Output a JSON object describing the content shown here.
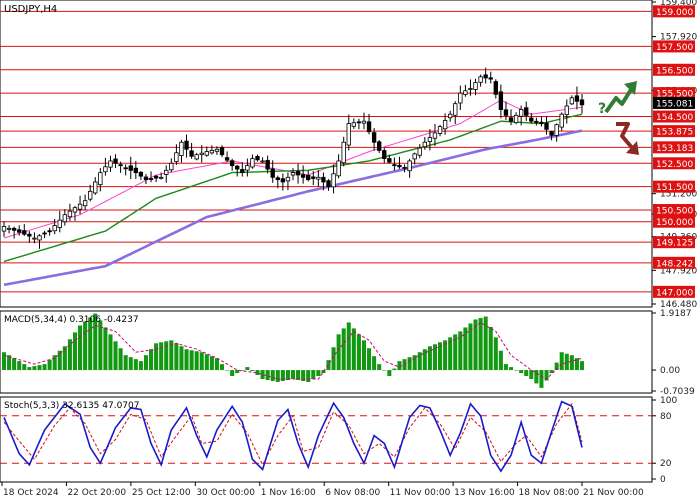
{
  "chart_data": {
    "type": "candlestick",
    "symbol_label": "USDJPY,H4",
    "price_axis": {
      "ylim": [
        146.48,
        159.4
      ],
      "ticks": [
        "159.400",
        "157.920",
        "155.620",
        "151.200",
        "150.320",
        "149.360",
        "147.920",
        "146.480"
      ]
    },
    "x_ticks": [
      "18 Oct 2024",
      "22 Oct 20:00",
      "25 Oct 12:00",
      "30 Oct 00:00",
      "1 Nov 16:00",
      "6 Nov 08:00",
      "11 Nov 00:00",
      "13 Nov 16:00",
      "18 Nov 08:00",
      "21 Nov 00:00"
    ],
    "levels": [
      {
        "label": "159.000",
        "value": 159.0
      },
      {
        "label": "157.500",
        "value": 157.5
      },
      {
        "label": "156.500",
        "value": 156.5
      },
      {
        "label": "155.500",
        "value": 155.5
      },
      {
        "label": "154.500",
        "value": 154.5
      },
      {
        "label": "153.875",
        "value": 153.875
      },
      {
        "label": "153.183",
        "value": 153.183
      },
      {
        "label": "152.500",
        "value": 152.5
      },
      {
        "label": "151.500",
        "value": 151.5
      },
      {
        "label": "150.500",
        "value": 150.5
      },
      {
        "label": "150.000",
        "value": 150.0
      },
      {
        "label": "149.125",
        "value": 149.125
      },
      {
        "label": "148.242",
        "value": 148.242
      },
      {
        "label": "147.000",
        "value": 147.0
      }
    ],
    "current_price": {
      "label": "155.081",
      "value": 155.081
    },
    "close_path": [
      [
        0,
        149.8
      ],
      [
        6,
        149.3
      ],
      [
        9,
        149.6
      ],
      [
        12,
        150.3
      ],
      [
        16,
        150.9
      ],
      [
        19,
        152.1
      ],
      [
        21,
        152.6
      ],
      [
        24,
        152.3
      ],
      [
        26,
        152.1
      ],
      [
        28,
        151.8
      ],
      [
        31,
        151.9
      ],
      [
        33,
        152.5
      ],
      [
        35,
        153.4
      ],
      [
        37,
        152.8
      ],
      [
        40,
        153.0
      ],
      [
        42,
        153.1
      ],
      [
        45,
        152.4
      ],
      [
        47,
        152.1
      ],
      [
        49,
        152.7
      ],
      [
        51,
        152.6
      ],
      [
        53,
        151.9
      ],
      [
        55,
        151.7
      ],
      [
        57,
        152.1
      ],
      [
        60,
        151.8
      ],
      [
        62,
        151.9
      ],
      [
        64,
        151.5
      ],
      [
        66,
        152.6
      ],
      [
        68,
        154.2
      ],
      [
        71,
        154.3
      ],
      [
        73,
        153.4
      ],
      [
        75,
        152.7
      ],
      [
        77,
        152.4
      ],
      [
        79,
        152.3
      ],
      [
        81,
        152.9
      ],
      [
        83,
        153.4
      ],
      [
        85,
        153.8
      ],
      [
        88,
        154.6
      ],
      [
        90,
        155.5
      ],
      [
        92,
        155.7
      ],
      [
        94,
        156.2
      ],
      [
        96,
        156.1
      ],
      [
        98,
        154.8
      ],
      [
        100,
        154.3
      ],
      [
        102,
        154.8
      ],
      [
        104,
        154.3
      ],
      [
        106,
        154.2
      ],
      [
        108,
        153.7
      ],
      [
        110,
        154.6
      ],
      [
        112,
        155.3
      ],
      [
        114,
        155.0
      ]
    ],
    "moving_averages": [
      {
        "color": "#ff44cc",
        "points": [
          [
            0,
            149.3
          ],
          [
            15,
            150.3
          ],
          [
            30,
            152.0
          ],
          [
            45,
            152.6
          ],
          [
            60,
            152.0
          ],
          [
            72,
            153.0
          ],
          [
            90,
            154.2
          ],
          [
            98,
            155.2
          ],
          [
            104,
            154.6
          ],
          [
            114,
            154.9
          ]
        ]
      },
      {
        "color": "#1c8a1c",
        "points": [
          [
            0,
            148.3
          ],
          [
            20,
            149.6
          ],
          [
            30,
            151.0
          ],
          [
            45,
            152.1
          ],
          [
            60,
            152.2
          ],
          [
            72,
            152.6
          ],
          [
            88,
            153.5
          ],
          [
            98,
            154.3
          ],
          [
            106,
            154.2
          ],
          [
            114,
            154.6
          ]
        ]
      },
      {
        "color": "#8a6de0",
        "points": [
          [
            0,
            147.3
          ],
          [
            20,
            148.1
          ],
          [
            40,
            150.2
          ],
          [
            60,
            151.3
          ],
          [
            80,
            152.3
          ],
          [
            95,
            153.1
          ],
          [
            105,
            153.5
          ],
          [
            114,
            153.9
          ]
        ]
      }
    ],
    "macd": {
      "title": "MACD(5,34,4) 0.3106 -0.4237",
      "ticks": [
        "1.9187",
        "0.00",
        "-0.7039"
      ],
      "ylim": [
        -0.7039,
        1.9187
      ],
      "color_hist": "#119911",
      "color_signal": "#cc0077",
      "hist_path": [
        [
          0,
          0.6
        ],
        [
          5,
          0.1
        ],
        [
          8,
          0.2
        ],
        [
          12,
          0.8
        ],
        [
          15,
          1.5
        ],
        [
          18,
          1.9
        ],
        [
          21,
          1.2
        ],
        [
          24,
          0.5
        ],
        [
          27,
          0.3
        ],
        [
          30,
          0.9
        ],
        [
          33,
          1.0
        ],
        [
          36,
          0.7
        ],
        [
          39,
          0.6
        ],
        [
          42,
          0.4
        ],
        [
          45,
          -0.2
        ],
        [
          48,
          0.1
        ],
        [
          51,
          -0.3
        ],
        [
          54,
          -0.4
        ],
        [
          57,
          -0.3
        ],
        [
          60,
          -0.4
        ],
        [
          63,
          -0.1
        ],
        [
          66,
          1.2
        ],
        [
          68,
          1.6
        ],
        [
          71,
          1.0
        ],
        [
          74,
          0.2
        ],
        [
          76,
          -0.2
        ],
        [
          78,
          0.3
        ],
        [
          81,
          0.5
        ],
        [
          84,
          0.8
        ],
        [
          87,
          1.0
        ],
        [
          90,
          1.3
        ],
        [
          93,
          1.7
        ],
        [
          95,
          1.8
        ],
        [
          97,
          1.1
        ],
        [
          99,
          0.2
        ],
        [
          102,
          -0.1
        ],
        [
          104,
          -0.3
        ],
        [
          106,
          -0.6
        ],
        [
          108,
          -0.1
        ],
        [
          110,
          0.6
        ],
        [
          112,
          0.5
        ],
        [
          114,
          0.3
        ]
      ],
      "signal_path": [
        [
          0,
          0.5
        ],
        [
          6,
          0.2
        ],
        [
          10,
          0.4
        ],
        [
          14,
          1.0
        ],
        [
          18,
          1.5
        ],
        [
          22,
          1.3
        ],
        [
          26,
          0.6
        ],
        [
          30,
          0.7
        ],
        [
          34,
          0.9
        ],
        [
          38,
          0.7
        ],
        [
          42,
          0.4
        ],
        [
          46,
          0.0
        ],
        [
          50,
          -0.1
        ],
        [
          54,
          -0.3
        ],
        [
          58,
          -0.3
        ],
        [
          62,
          -0.3
        ],
        [
          66,
          0.7
        ],
        [
          69,
          1.3
        ],
        [
          72,
          1.0
        ],
        [
          75,
          0.3
        ],
        [
          78,
          0.1
        ],
        [
          82,
          0.5
        ],
        [
          86,
          0.8
        ],
        [
          90,
          1.1
        ],
        [
          94,
          1.6
        ],
        [
          97,
          1.3
        ],
        [
          100,
          0.5
        ],
        [
          104,
          0.0
        ],
        [
          107,
          -0.3
        ],
        [
          110,
          0.2
        ],
        [
          114,
          0.4
        ]
      ]
    },
    "stochastic": {
      "title": "Stoch(5,3,3) 32.6135 47.0707",
      "ticks": [
        "100",
        "80",
        "20",
        "0"
      ],
      "ylim": [
        0,
        100
      ],
      "levels": [
        80,
        20
      ],
      "color_main": "#1a1acc",
      "color_signal": "#cc1111",
      "main_path": [
        [
          0,
          78
        ],
        [
          3,
          32
        ],
        [
          5,
          18
        ],
        [
          8,
          62
        ],
        [
          12,
          95
        ],
        [
          15,
          82
        ],
        [
          17,
          40
        ],
        [
          19,
          20
        ],
        [
          22,
          65
        ],
        [
          25,
          90
        ],
        [
          27,
          88
        ],
        [
          29,
          45
        ],
        [
          31,
          18
        ],
        [
          33,
          62
        ],
        [
          36,
          90
        ],
        [
          38,
          55
        ],
        [
          40,
          28
        ],
        [
          42,
          62
        ],
        [
          45,
          92
        ],
        [
          47,
          72
        ],
        [
          49,
          25
        ],
        [
          51,
          12
        ],
        [
          54,
          74
        ],
        [
          56,
          88
        ],
        [
          58,
          45
        ],
        [
          60,
          15
        ],
        [
          62,
          55
        ],
        [
          65,
          96
        ],
        [
          67,
          78
        ],
        [
          69,
          45
        ],
        [
          71,
          20
        ],
        [
          73,
          55
        ],
        [
          75,
          45
        ],
        [
          77,
          15
        ],
        [
          80,
          78
        ],
        [
          82,
          93
        ],
        [
          84,
          90
        ],
        [
          86,
          62
        ],
        [
          88,
          30
        ],
        [
          90,
          58
        ],
        [
          92,
          95
        ],
        [
          94,
          80
        ],
        [
          96,
          30
        ],
        [
          98,
          10
        ],
        [
          100,
          30
        ],
        [
          102,
          72
        ],
        [
          104,
          30
        ],
        [
          106,
          20
        ],
        [
          108,
          60
        ],
        [
          110,
          98
        ],
        [
          112,
          92
        ],
        [
          114,
          40
        ]
      ],
      "signal_path": [
        [
          0,
          72
        ],
        [
          3,
          48
        ],
        [
          6,
          25
        ],
        [
          10,
          68
        ],
        [
          13,
          90
        ],
        [
          16,
          70
        ],
        [
          19,
          32
        ],
        [
          22,
          50
        ],
        [
          25,
          82
        ],
        [
          28,
          75
        ],
        [
          31,
          28
        ],
        [
          34,
          55
        ],
        [
          37,
          80
        ],
        [
          39,
          45
        ],
        [
          42,
          48
        ],
        [
          45,
          82
        ],
        [
          48,
          58
        ],
        [
          51,
          18
        ],
        [
          54,
          55
        ],
        [
          57,
          80
        ],
        [
          59,
          35
        ],
        [
          62,
          40
        ],
        [
          65,
          85
        ],
        [
          68,
          68
        ],
        [
          71,
          32
        ],
        [
          74,
          45
        ],
        [
          77,
          28
        ],
        [
          80,
          65
        ],
        [
          83,
          90
        ],
        [
          86,
          70
        ],
        [
          89,
          38
        ],
        [
          92,
          78
        ],
        [
          95,
          60
        ],
        [
          98,
          22
        ],
        [
          101,
          45
        ],
        [
          103,
          55
        ],
        [
          106,
          28
        ],
        [
          109,
          70
        ],
        [
          112,
          95
        ],
        [
          114,
          47
        ]
      ]
    }
  }
}
